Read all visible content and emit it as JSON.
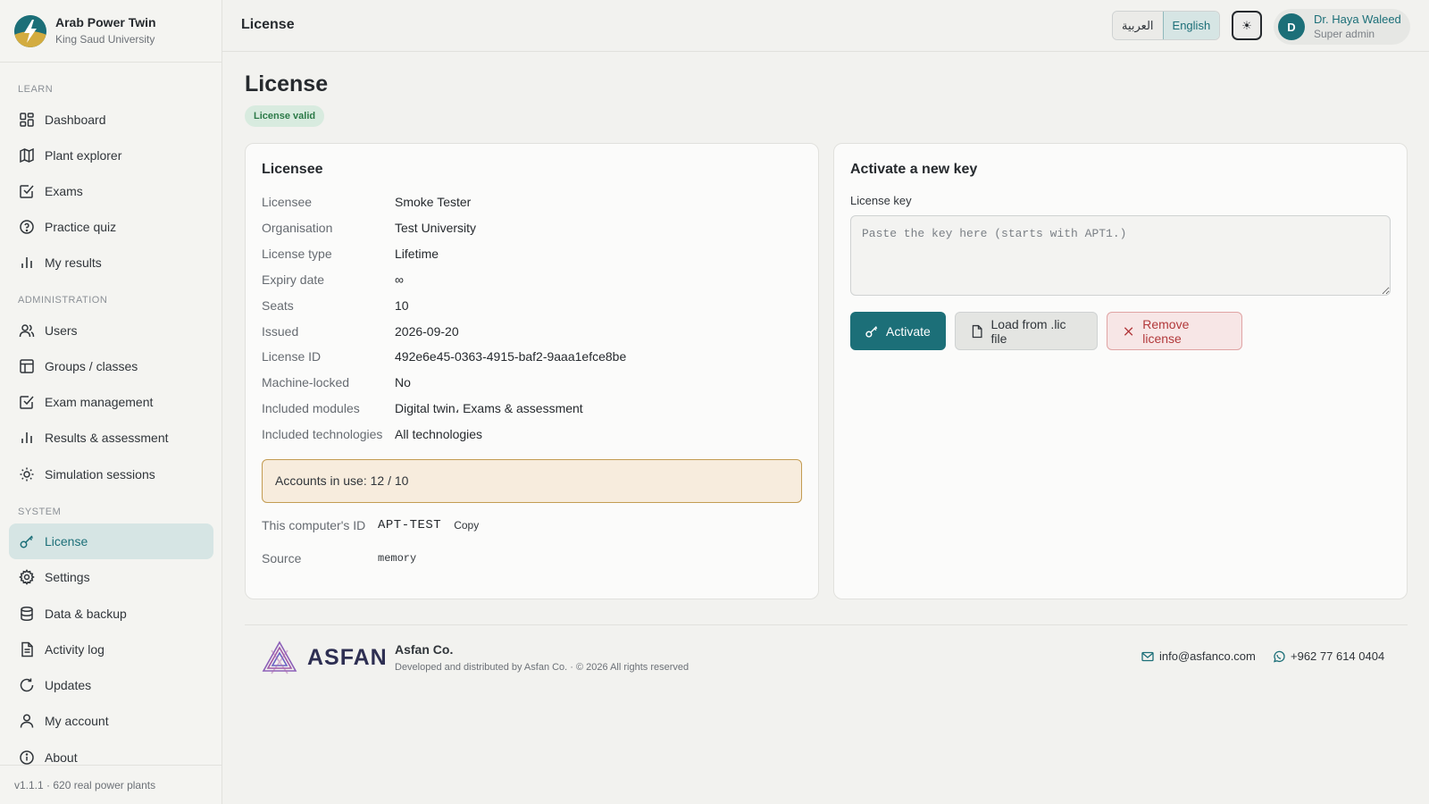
{
  "app": {
    "title": "Arab Power Twin",
    "subtitle": "King Saud University",
    "version": "v1.1.1 · 620 real power plants"
  },
  "sidebar": {
    "sections": {
      "learn": "LEARN",
      "administration": "ADMINISTRATION",
      "system": "SYSTEM"
    },
    "items": [
      {
        "label": "Dashboard",
        "icon": "dashboard-icon"
      },
      {
        "label": "Plant explorer",
        "icon": "map-icon"
      },
      {
        "label": "Exams",
        "icon": "check-square-icon"
      },
      {
        "label": "Practice quiz",
        "icon": "help-circle-icon"
      },
      {
        "label": "My results",
        "icon": "bar-chart-icon"
      },
      {
        "label": "Users",
        "icon": "users-icon"
      },
      {
        "label": "Groups / classes",
        "icon": "table-icon"
      },
      {
        "label": "Exam management",
        "icon": "check-square-icon"
      },
      {
        "label": "Results & assessment",
        "icon": "bar-chart-icon"
      },
      {
        "label": "Simulation sessions",
        "icon": "sun-icon"
      },
      {
        "label": "License",
        "icon": "key-icon",
        "active": true
      },
      {
        "label": "Settings",
        "icon": "gear-icon"
      },
      {
        "label": "Data & backup",
        "icon": "database-icon"
      },
      {
        "label": "Activity log",
        "icon": "file-text-icon"
      },
      {
        "label": "Updates",
        "icon": "refresh-icon"
      },
      {
        "label": "My account",
        "icon": "user-icon"
      },
      {
        "label": "About",
        "icon": "info-icon"
      }
    ]
  },
  "header": {
    "title": "License",
    "lang_ar": "العربية",
    "lang_en": "English",
    "theme_glyph": "☀",
    "user_initial": "D",
    "user_name": "Dr. Haya Waleed",
    "user_role": "Super admin"
  },
  "main": {
    "title": "License",
    "status": "License valid",
    "licensee_card": {
      "title": "Licensee",
      "rows": [
        {
          "label": "Licensee",
          "value": "Smoke Tester"
        },
        {
          "label": "Organisation",
          "value": "Test University"
        },
        {
          "label": "License type",
          "value": "Lifetime"
        },
        {
          "label": "Expiry date",
          "value": "∞"
        },
        {
          "label": "Seats",
          "value": "10"
        },
        {
          "label": "Issued",
          "value": "2026-09-20"
        },
        {
          "label": "License ID",
          "value": "492e6e45-0363-4915-baf2-9aaa1efce8be"
        },
        {
          "label": "Machine-locked",
          "value": "No"
        },
        {
          "label": "Included modules",
          "value": "Digital twin، Exams & assessment"
        },
        {
          "label": "Included technologies",
          "value": "All technologies"
        }
      ],
      "accounts": "Accounts in use: 12 / 10",
      "machine_label": "This computer's ID",
      "machine_id": "APT-TEST",
      "copy_label": "Copy",
      "source_label": "Source",
      "source_value": "memory"
    },
    "activate_card": {
      "title": "Activate a new key",
      "field_label": "License key",
      "placeholder": "Paste the key here (starts with APT1.)",
      "value": "",
      "activate_label": "Activate",
      "load_label": "Load from .lic file",
      "remove_label": "Remove license"
    }
  },
  "footer": {
    "logo_word": "ASFAN",
    "company": "Asfan Co.",
    "copyright": "Developed and distributed by Asfan Co. · © 2026 All rights reserved",
    "email": "info@asfanco.com",
    "phone": "+962 77 614 0404"
  },
  "colors": {
    "accent": "#1c6f78",
    "success": "#2c7a48",
    "warning_border": "#c39c52",
    "danger": "#b2393b"
  }
}
